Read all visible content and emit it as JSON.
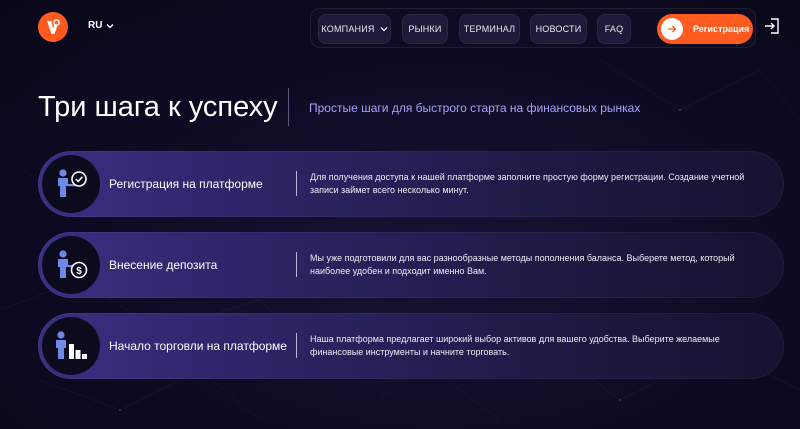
{
  "header": {
    "lang": "RU",
    "nav": [
      {
        "label": "КОМПАНИЯ",
        "has_dropdown": true
      },
      {
        "label": "РЫНКИ"
      },
      {
        "label": "ТЕРМИНАЛ"
      },
      {
        "label": "НОВОСТИ"
      },
      {
        "label": "FAQ"
      }
    ],
    "register_label": "Регистрация",
    "icons": {
      "logo": "brand-logo",
      "lang_chevron": "chevron-down-icon",
      "register_arrow": "arrow-right-icon",
      "login": "login-icon"
    }
  },
  "colors": {
    "accent": "#ff5a1f",
    "subtitle": "#a7a3ff",
    "background": "#0d0b23",
    "card_left": "#3a2f82"
  },
  "section": {
    "title": "Три шага к успеху",
    "subtitle": "Простые шаги для быстрого старта на финансовых рынках"
  },
  "steps": [
    {
      "title": "Регистрация на платформе",
      "text": "Для получения доступа к нашей платформе заполните простую форму регистрации. Создание учетной записи займет всего несколько минут.",
      "icon": "person-check-icon"
    },
    {
      "title": "Внесение депозита",
      "text": "Мы уже подготовили для вас разнообразные методы пополнения баланса. Выберете метод, который наиболее удобен и подходит именно Вам.",
      "icon": "person-dollar-icon"
    },
    {
      "title": "Начало торговли на платформе",
      "text": "Наша платформа предлагает широкий выбор активов для вашего удобства. Выберите желаемые финансовые инструменты и начните торговать.",
      "icon": "person-chart-icon"
    }
  ]
}
